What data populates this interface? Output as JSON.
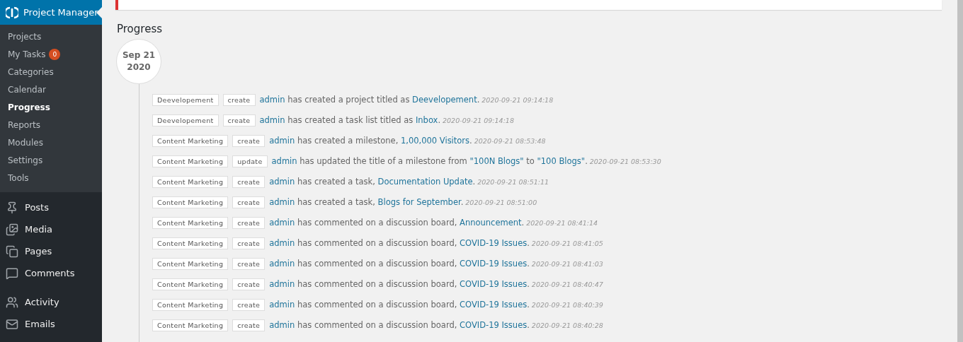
{
  "sidebar": {
    "header": {
      "label": "Project Manager",
      "selected": true
    },
    "submenu": [
      {
        "label": "Projects",
        "selected": false
      },
      {
        "label": "My Tasks",
        "selected": false,
        "badge": "0"
      },
      {
        "label": "Categories",
        "selected": false
      },
      {
        "label": "Calendar",
        "selected": false
      },
      {
        "label": "Progress",
        "selected": true
      },
      {
        "label": "Reports",
        "selected": false
      },
      {
        "label": "Modules",
        "selected": false
      },
      {
        "label": "Settings",
        "selected": false
      },
      {
        "label": "Tools",
        "selected": false
      }
    ],
    "menu_groups": [
      {
        "items": [
          {
            "label": "Posts",
            "kind": "pin"
          },
          {
            "label": "Media",
            "kind": "media"
          },
          {
            "label": "Pages",
            "kind": "pages"
          },
          {
            "label": "Comments",
            "kind": "comment"
          }
        ]
      },
      {
        "items": [
          {
            "label": "Activity",
            "kind": "activity"
          },
          {
            "label": "Emails",
            "kind": "mail"
          }
        ]
      }
    ]
  },
  "page": {
    "title": "Progress",
    "date": {
      "month_day": "Sep 21",
      "year": "2020"
    },
    "entries": [
      {
        "project": "Deevelopement",
        "action": "create",
        "parts": [
          {
            "text": "admin",
            "link": true
          },
          {
            "text": " has created a project titled as ",
            "link": false
          },
          {
            "text": "Deevelopement",
            "link": true
          },
          {
            "text": ".",
            "link": false
          }
        ],
        "time": "2020-09-21 09:14:18"
      },
      {
        "project": "Deevelopement",
        "action": "create",
        "parts": [
          {
            "text": "admin",
            "link": true
          },
          {
            "text": " has created a task list titled as ",
            "link": false
          },
          {
            "text": "Inbox",
            "link": true
          },
          {
            "text": ".",
            "link": false
          }
        ],
        "time": "2020-09-21 09:14:18"
      },
      {
        "project": "Content Marketing",
        "action": "create",
        "parts": [
          {
            "text": "admin",
            "link": true
          },
          {
            "text": " has created a milestone, ",
            "link": false
          },
          {
            "text": "1,00,000 Visitors",
            "link": true
          },
          {
            "text": ".",
            "link": false
          }
        ],
        "time": "2020-09-21 08:53:48"
      },
      {
        "project": "Content Marketing",
        "action": "update",
        "parts": [
          {
            "text": "admin",
            "link": true
          },
          {
            "text": " has updated the title of a milestone from ",
            "link": false
          },
          {
            "text": "\"100N Blogs\"",
            "link": true
          },
          {
            "text": " to ",
            "link": false
          },
          {
            "text": "\"100 Blogs\"",
            "link": true
          },
          {
            "text": ".",
            "link": false
          }
        ],
        "time": "2020-09-21 08:53:30"
      },
      {
        "project": "Content Marketing",
        "action": "create",
        "parts": [
          {
            "text": "admin",
            "link": true
          },
          {
            "text": " has created a task, ",
            "link": false
          },
          {
            "text": "Documentation Update",
            "link": true
          },
          {
            "text": ".",
            "link": false
          }
        ],
        "time": "2020-09-21 08:51:11"
      },
      {
        "project": "Content Marketing",
        "action": "create",
        "parts": [
          {
            "text": "admin",
            "link": true
          },
          {
            "text": " has created a task, ",
            "link": false
          },
          {
            "text": "Blogs for September",
            "link": true
          },
          {
            "text": ".",
            "link": false
          }
        ],
        "time": "2020-09-21 08:51:00"
      },
      {
        "project": "Content Marketing",
        "action": "create",
        "parts": [
          {
            "text": "admin",
            "link": true
          },
          {
            "text": " has commented on a discussion board, ",
            "link": false
          },
          {
            "text": "Announcement",
            "link": true
          },
          {
            "text": ".",
            "link": false
          }
        ],
        "time": "2020-09-21 08:41:14"
      },
      {
        "project": "Content Marketing",
        "action": "create",
        "parts": [
          {
            "text": "admin",
            "link": true
          },
          {
            "text": " has commented on a discussion board, ",
            "link": false
          },
          {
            "text": "COVID-19 Issues",
            "link": true
          },
          {
            "text": ".",
            "link": false
          }
        ],
        "time": "2020-09-21 08:41:05"
      },
      {
        "project": "Content Marketing",
        "action": "create",
        "parts": [
          {
            "text": "admin",
            "link": true
          },
          {
            "text": " has commented on a discussion board, ",
            "link": false
          },
          {
            "text": "COVID-19 Issues",
            "link": true
          },
          {
            "text": ".",
            "link": false
          }
        ],
        "time": "2020-09-21 08:41:03"
      },
      {
        "project": "Content Marketing",
        "action": "create",
        "parts": [
          {
            "text": "admin",
            "link": true
          },
          {
            "text": " has commented on a discussion board, ",
            "link": false
          },
          {
            "text": "COVID-19 Issues",
            "link": true
          },
          {
            "text": ".",
            "link": false
          }
        ],
        "time": "2020-09-21 08:40:47"
      },
      {
        "project": "Content Marketing",
        "action": "create",
        "parts": [
          {
            "text": "admin",
            "link": true
          },
          {
            "text": " has commented on a discussion board, ",
            "link": false
          },
          {
            "text": "COVID-19 Issues",
            "link": true
          },
          {
            "text": ".",
            "link": false
          }
        ],
        "time": "2020-09-21 08:40:39"
      },
      {
        "project": "Content Marketing",
        "action": "create",
        "parts": [
          {
            "text": "admin",
            "link": true
          },
          {
            "text": " has commented on a discussion board, ",
            "link": false
          },
          {
            "text": "COVID-19 Issues",
            "link": true
          },
          {
            "text": ".",
            "link": false
          }
        ],
        "time": "2020-09-21 08:40:28"
      }
    ]
  }
}
